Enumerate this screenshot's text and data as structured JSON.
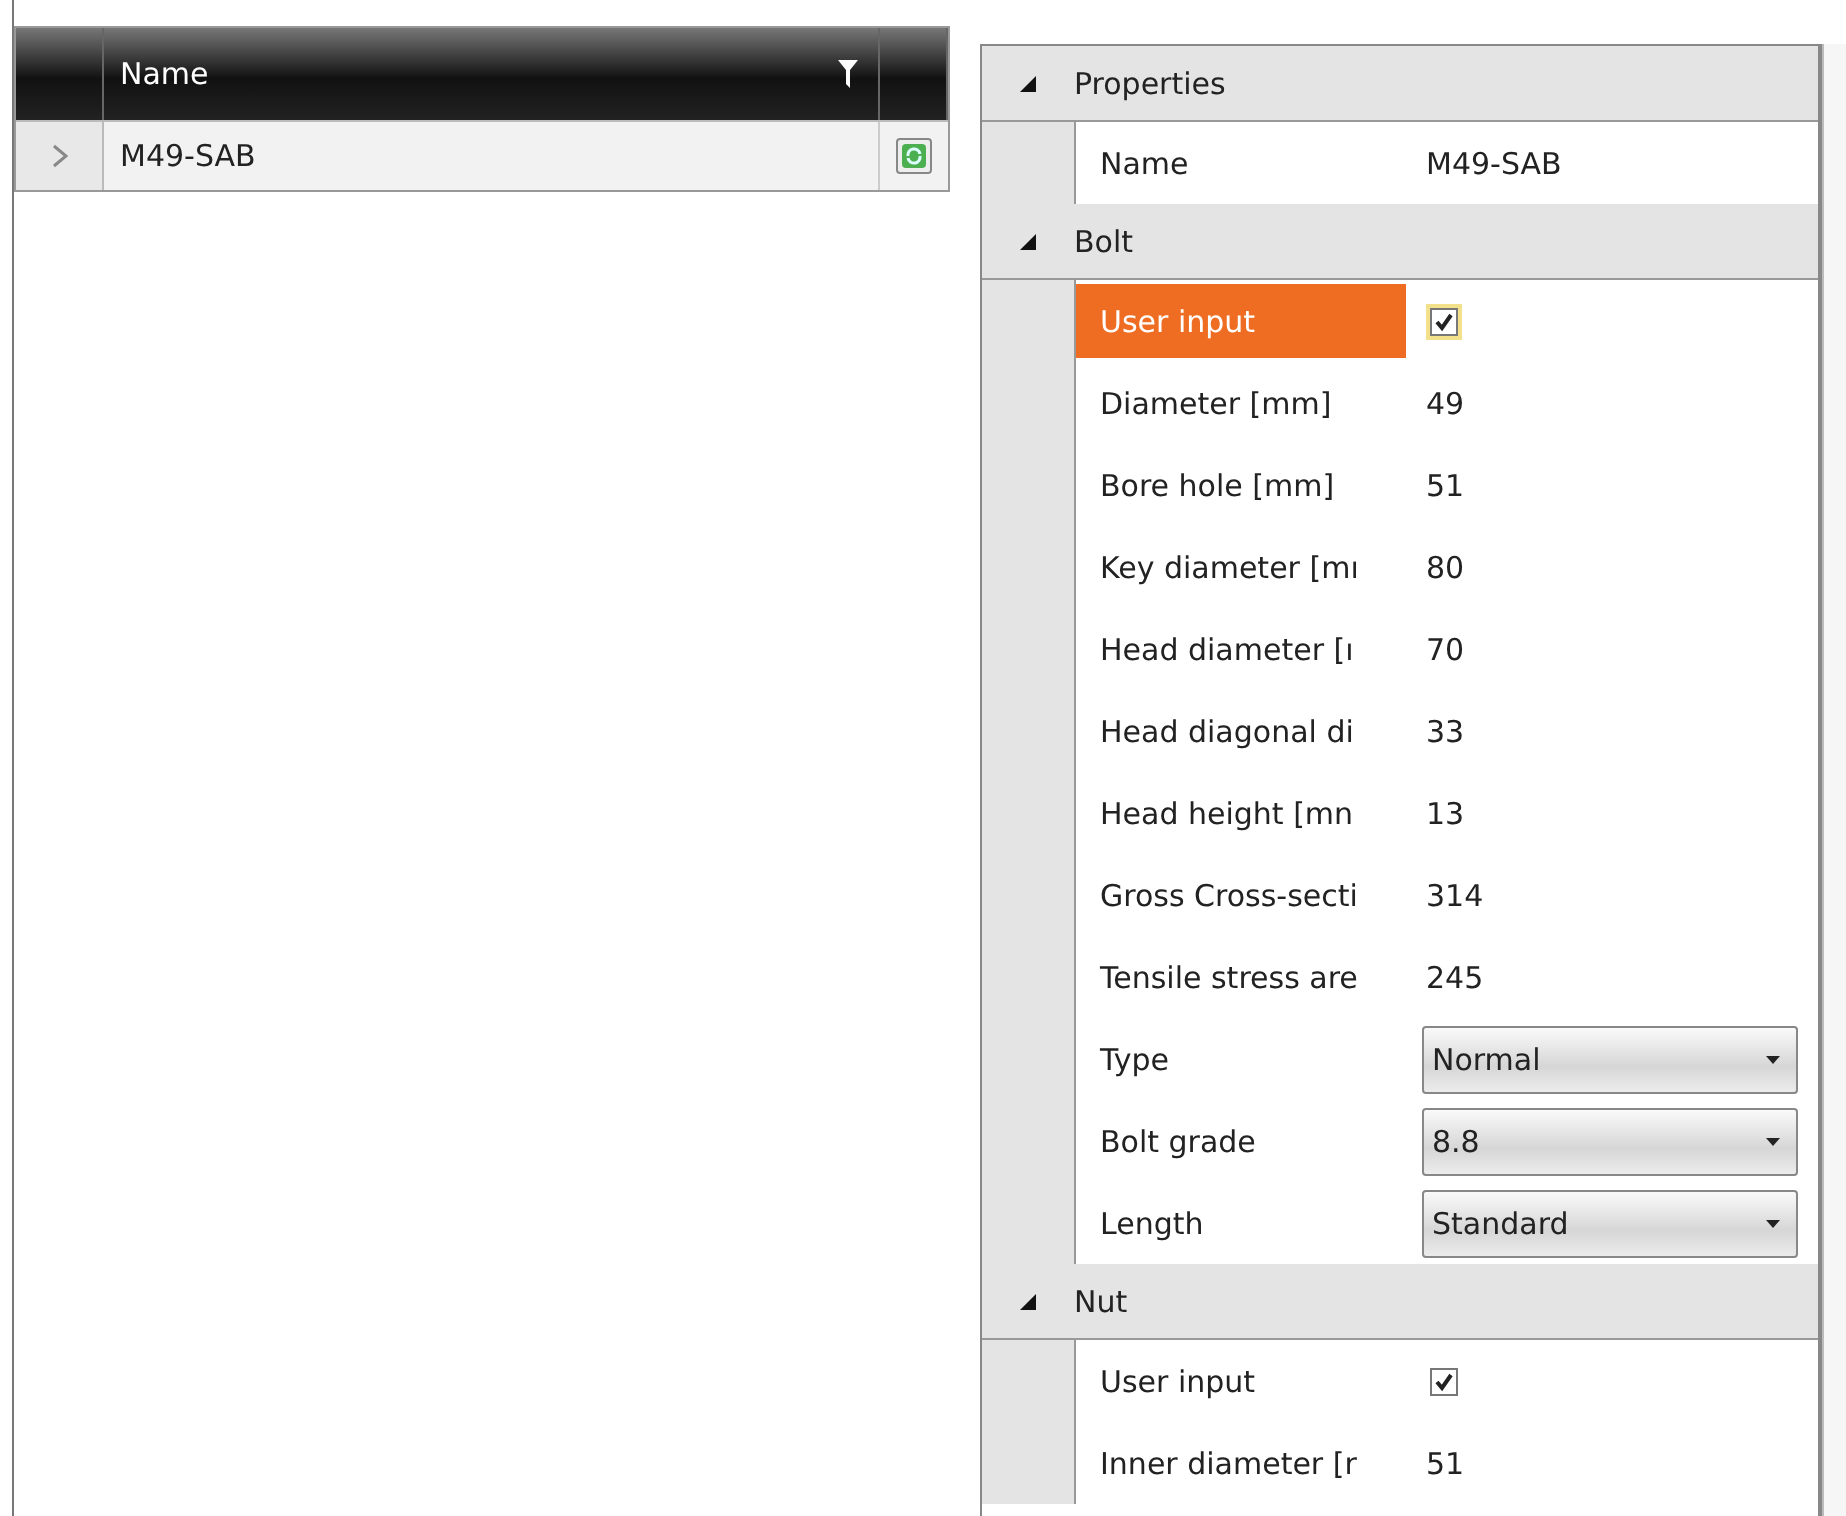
{
  "grid": {
    "columns": [
      {
        "label": "Name"
      }
    ],
    "rows": [
      {
        "name": "M49-SAB",
        "selected": false
      }
    ]
  },
  "properties": {
    "sections": [
      {
        "title": "Properties",
        "expanded": true,
        "rows": [
          {
            "kind": "text",
            "label": "Name",
            "value": "M49-SAB",
            "selected": false
          }
        ]
      },
      {
        "title": "Bolt",
        "expanded": true,
        "rows": [
          {
            "kind": "checkbox",
            "label": "User input",
            "checked": true,
            "selected": true
          },
          {
            "kind": "text",
            "label": "Diameter [mm]",
            "value": "49",
            "selected": false
          },
          {
            "kind": "text",
            "label": "Bore hole [mm]",
            "value": "51",
            "selected": false
          },
          {
            "kind": "text",
            "label": "Key diameter [mı",
            "value": "80",
            "selected": false
          },
          {
            "kind": "text",
            "label": "Head diameter [ı",
            "value": "70",
            "selected": false
          },
          {
            "kind": "text",
            "label": "Head diagonal di",
            "value": "33",
            "selected": false
          },
          {
            "kind": "text",
            "label": "Head height [mn",
            "value": "13",
            "selected": false
          },
          {
            "kind": "text",
            "label": "Gross Cross-secti",
            "value": "314",
            "selected": false
          },
          {
            "kind": "text",
            "label": "Tensile stress are",
            "value": "245",
            "selected": false
          },
          {
            "kind": "dropdown",
            "label": "Type",
            "value": "Normal",
            "selected": false
          },
          {
            "kind": "dropdown",
            "label": "Bolt grade",
            "value": "8.8",
            "selected": false
          },
          {
            "kind": "dropdown",
            "label": "Length",
            "value": "Standard",
            "selected": false
          }
        ]
      },
      {
        "title": "Nut",
        "expanded": true,
        "rows": [
          {
            "kind": "checkbox",
            "label": "User input",
            "checked": true,
            "selected": false
          },
          {
            "kind": "text",
            "label": "Inner diameter [r",
            "value": "51",
            "selected": false
          }
        ]
      }
    ]
  }
}
